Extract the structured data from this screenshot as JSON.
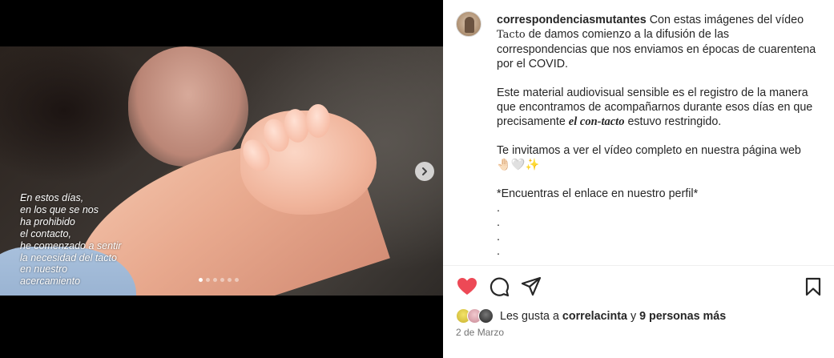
{
  "post": {
    "caption_overlay": "En estos días,\nen los que se nos\nha prohibido\nel contacto,\nhe comenzado a sentir\nla necesidad del tacto\nen nuestro\nacercamiento",
    "carousel": {
      "total": 6,
      "active_index": 0
    }
  },
  "comment": {
    "username": "correspondenciasmutantes",
    "p1_intro": " Con estas imágenes del vídeo ",
    "p1_title": "Tacto",
    "p1_rest": " de damos comienzo a la difusión de las correspondencias que nos enviamos en épocas de cuarentena por el COVID.",
    "p2_start": "Este material audiovisual sensible es el registro de la manera que encontramos de acompañarnos durante esos días en que precisamente ",
    "p2_em": "el con-tacto",
    "p2_end": " estuvo restringido.",
    "p3": "Te invitamos a ver el vídeo completo en nuestra página web",
    "p3_emojis": "🤚🏻🤍✨",
    "p4": "*Encuentras el enlace en nuestro perfil*",
    "dots": [
      ".",
      ".",
      ".",
      "."
    ]
  },
  "likes": {
    "prefix": "Les gusta a ",
    "user": "correlacinta",
    "connector": " y ",
    "others": "9 personas más"
  },
  "date": "2 de Marzo",
  "colors": {
    "heart": "#ed4956",
    "text": "#262626",
    "muted": "#737373"
  },
  "icons": [
    "heart-icon",
    "comment-icon",
    "share-icon",
    "bookmark-icon",
    "chevron-right-icon"
  ]
}
